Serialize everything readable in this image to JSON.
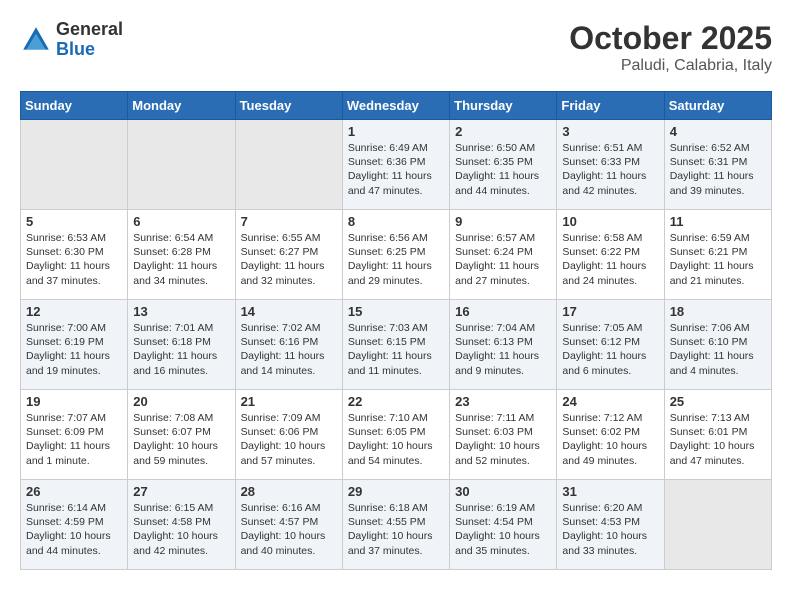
{
  "header": {
    "logo_general": "General",
    "logo_blue": "Blue",
    "month": "October 2025",
    "location": "Paludi, Calabria, Italy"
  },
  "weekdays": [
    "Sunday",
    "Monday",
    "Tuesday",
    "Wednesday",
    "Thursday",
    "Friday",
    "Saturday"
  ],
  "weeks": [
    [
      {
        "day": "",
        "info": ""
      },
      {
        "day": "",
        "info": ""
      },
      {
        "day": "",
        "info": ""
      },
      {
        "day": "1",
        "info": "Sunrise: 6:49 AM\nSunset: 6:36 PM\nDaylight: 11 hours and 47 minutes."
      },
      {
        "day": "2",
        "info": "Sunrise: 6:50 AM\nSunset: 6:35 PM\nDaylight: 11 hours and 44 minutes."
      },
      {
        "day": "3",
        "info": "Sunrise: 6:51 AM\nSunset: 6:33 PM\nDaylight: 11 hours and 42 minutes."
      },
      {
        "day": "4",
        "info": "Sunrise: 6:52 AM\nSunset: 6:31 PM\nDaylight: 11 hours and 39 minutes."
      }
    ],
    [
      {
        "day": "5",
        "info": "Sunrise: 6:53 AM\nSunset: 6:30 PM\nDaylight: 11 hours and 37 minutes."
      },
      {
        "day": "6",
        "info": "Sunrise: 6:54 AM\nSunset: 6:28 PM\nDaylight: 11 hours and 34 minutes."
      },
      {
        "day": "7",
        "info": "Sunrise: 6:55 AM\nSunset: 6:27 PM\nDaylight: 11 hours and 32 minutes."
      },
      {
        "day": "8",
        "info": "Sunrise: 6:56 AM\nSunset: 6:25 PM\nDaylight: 11 hours and 29 minutes."
      },
      {
        "day": "9",
        "info": "Sunrise: 6:57 AM\nSunset: 6:24 PM\nDaylight: 11 hours and 27 minutes."
      },
      {
        "day": "10",
        "info": "Sunrise: 6:58 AM\nSunset: 6:22 PM\nDaylight: 11 hours and 24 minutes."
      },
      {
        "day": "11",
        "info": "Sunrise: 6:59 AM\nSunset: 6:21 PM\nDaylight: 11 hours and 21 minutes."
      }
    ],
    [
      {
        "day": "12",
        "info": "Sunrise: 7:00 AM\nSunset: 6:19 PM\nDaylight: 11 hours and 19 minutes."
      },
      {
        "day": "13",
        "info": "Sunrise: 7:01 AM\nSunset: 6:18 PM\nDaylight: 11 hours and 16 minutes."
      },
      {
        "day": "14",
        "info": "Sunrise: 7:02 AM\nSunset: 6:16 PM\nDaylight: 11 hours and 14 minutes."
      },
      {
        "day": "15",
        "info": "Sunrise: 7:03 AM\nSunset: 6:15 PM\nDaylight: 11 hours and 11 minutes."
      },
      {
        "day": "16",
        "info": "Sunrise: 7:04 AM\nSunset: 6:13 PM\nDaylight: 11 hours and 9 minutes."
      },
      {
        "day": "17",
        "info": "Sunrise: 7:05 AM\nSunset: 6:12 PM\nDaylight: 11 hours and 6 minutes."
      },
      {
        "day": "18",
        "info": "Sunrise: 7:06 AM\nSunset: 6:10 PM\nDaylight: 11 hours and 4 minutes."
      }
    ],
    [
      {
        "day": "19",
        "info": "Sunrise: 7:07 AM\nSunset: 6:09 PM\nDaylight: 11 hours and 1 minute."
      },
      {
        "day": "20",
        "info": "Sunrise: 7:08 AM\nSunset: 6:07 PM\nDaylight: 10 hours and 59 minutes."
      },
      {
        "day": "21",
        "info": "Sunrise: 7:09 AM\nSunset: 6:06 PM\nDaylight: 10 hours and 57 minutes."
      },
      {
        "day": "22",
        "info": "Sunrise: 7:10 AM\nSunset: 6:05 PM\nDaylight: 10 hours and 54 minutes."
      },
      {
        "day": "23",
        "info": "Sunrise: 7:11 AM\nSunset: 6:03 PM\nDaylight: 10 hours and 52 minutes."
      },
      {
        "day": "24",
        "info": "Sunrise: 7:12 AM\nSunset: 6:02 PM\nDaylight: 10 hours and 49 minutes."
      },
      {
        "day": "25",
        "info": "Sunrise: 7:13 AM\nSunset: 6:01 PM\nDaylight: 10 hours and 47 minutes."
      }
    ],
    [
      {
        "day": "26",
        "info": "Sunrise: 6:14 AM\nSunset: 4:59 PM\nDaylight: 10 hours and 44 minutes."
      },
      {
        "day": "27",
        "info": "Sunrise: 6:15 AM\nSunset: 4:58 PM\nDaylight: 10 hours and 42 minutes."
      },
      {
        "day": "28",
        "info": "Sunrise: 6:16 AM\nSunset: 4:57 PM\nDaylight: 10 hours and 40 minutes."
      },
      {
        "day": "29",
        "info": "Sunrise: 6:18 AM\nSunset: 4:55 PM\nDaylight: 10 hours and 37 minutes."
      },
      {
        "day": "30",
        "info": "Sunrise: 6:19 AM\nSunset: 4:54 PM\nDaylight: 10 hours and 35 minutes."
      },
      {
        "day": "31",
        "info": "Sunrise: 6:20 AM\nSunset: 4:53 PM\nDaylight: 10 hours and 33 minutes."
      },
      {
        "day": "",
        "info": ""
      }
    ]
  ]
}
